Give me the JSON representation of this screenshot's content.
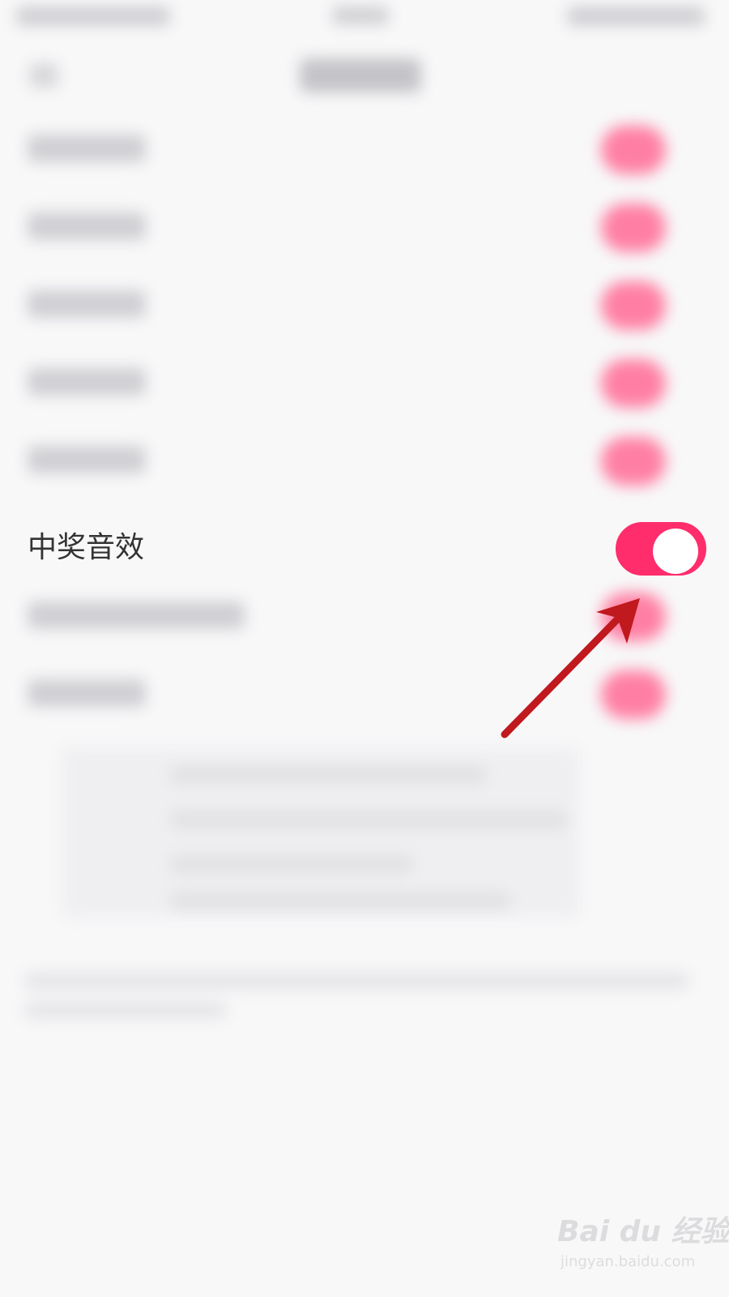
{
  "setting": {
    "label": "中奖音效",
    "enabled": true
  },
  "toggle_color": "#ff2d6b",
  "annotation_arrow_color": "#c0191e",
  "watermark": {
    "brand": "Bai du 经验",
    "url": "jingyan.baidu.com"
  }
}
